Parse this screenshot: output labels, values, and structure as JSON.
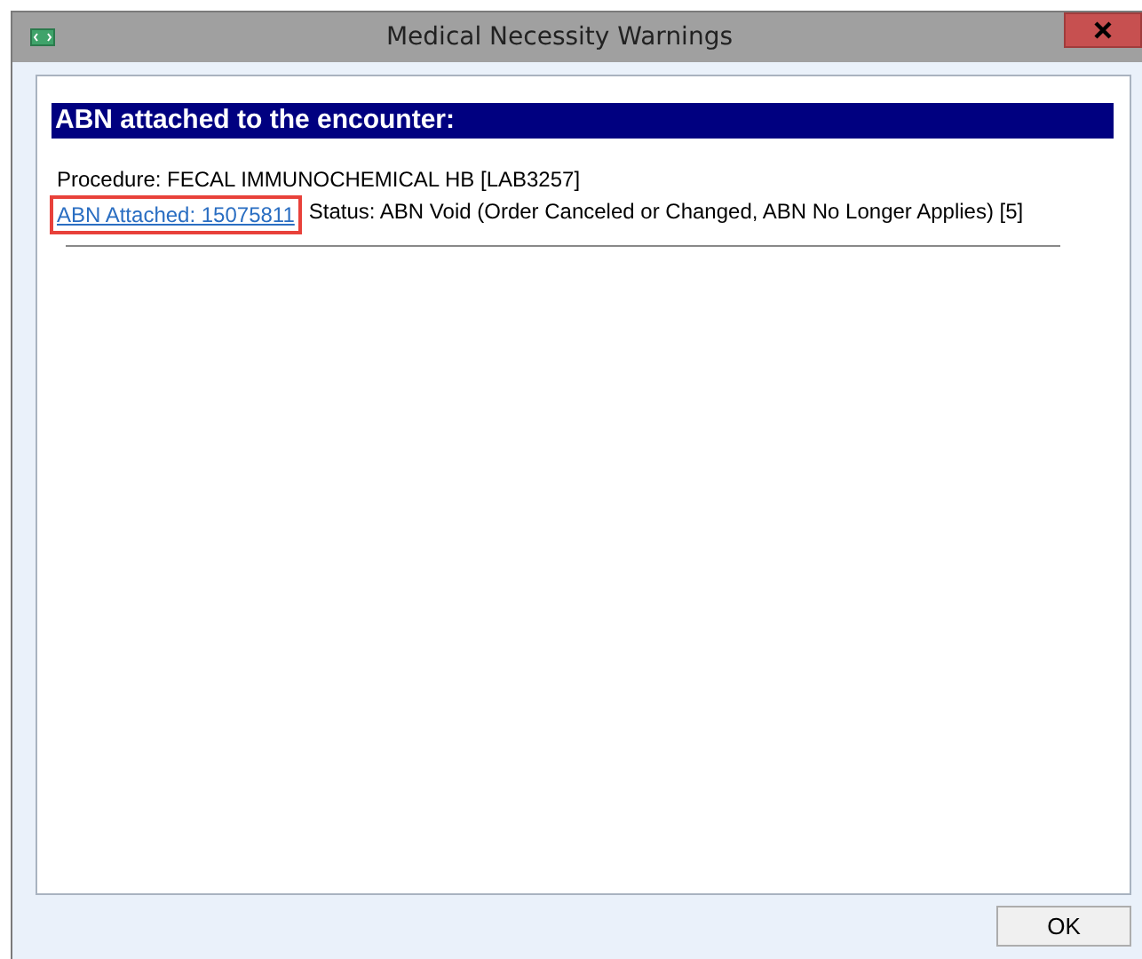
{
  "window": {
    "title": "Medical Necessity Warnings"
  },
  "section": {
    "heading": "ABN attached to the encounter:"
  },
  "procedure": "Procedure: FECAL IMMUNOCHEMICAL HB [LAB3257]",
  "abn_link": {
    "text": "ABN Attached: 15075811",
    "highlighted": true
  },
  "status": "Status: ABN Void (Order Canceled or Changed, ABN No Longer Applies) [5]",
  "buttons": [
    {
      "label": "OK"
    }
  ]
}
